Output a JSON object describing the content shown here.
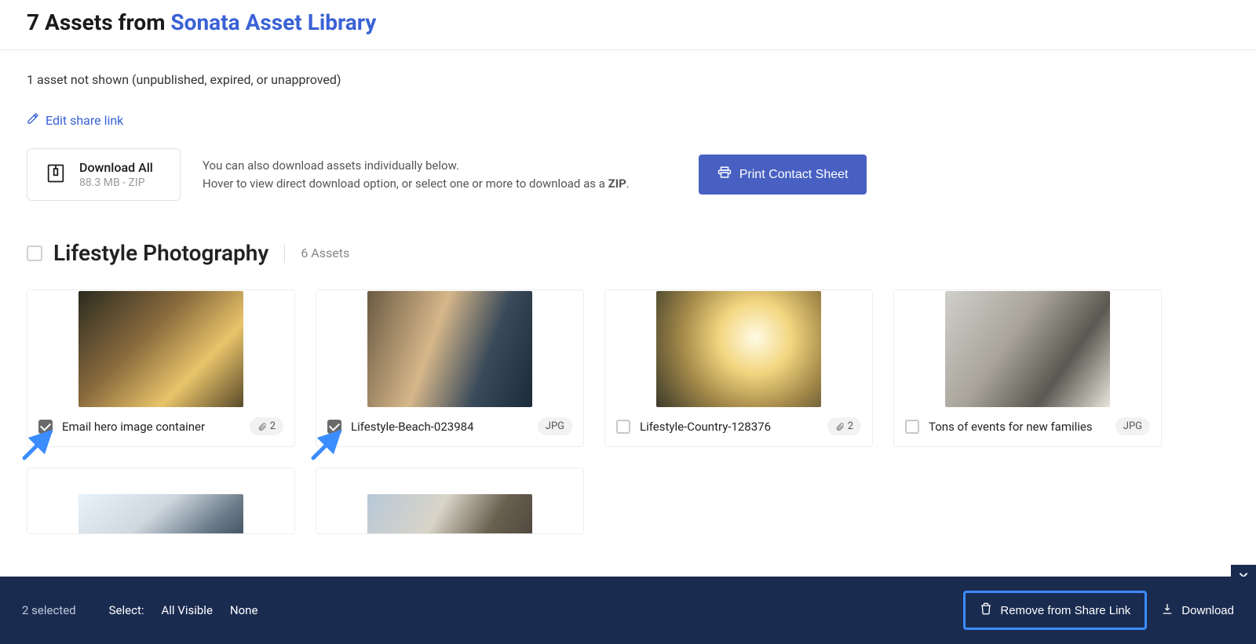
{
  "header": {
    "prefix": "7 Assets from ",
    "link": "Sonata Asset Library"
  },
  "not_shown": "1 asset not shown (unpublished, expired, or unapproved)",
  "edit_link": "Edit share link",
  "download_all": {
    "label": "Download All",
    "sub": "88.3 MB - ZIP"
  },
  "help_line1": "You can also download assets individually below.",
  "help_line2_a": "Hover to view direct download option, or select one or more to download as a ",
  "help_line2_b": "ZIP",
  "help_line2_c": ".",
  "print_btn": "Print Contact Sheet",
  "section": {
    "title": "Lifestyle Photography",
    "count": "6 Assets"
  },
  "assets": [
    {
      "name": "Email hero image container",
      "badge_type": "attach",
      "badge_text": "2",
      "checked": true,
      "img": "img-a"
    },
    {
      "name": "Lifestyle-Beach-023984",
      "badge_type": "text",
      "badge_text": "JPG",
      "checked": true,
      "img": "img-b"
    },
    {
      "name": "Lifestyle-Country-128376",
      "badge_type": "attach",
      "badge_text": "2",
      "checked": false,
      "img": "img-c"
    },
    {
      "name": "Tons of events for new families",
      "badge_type": "text",
      "badge_text": "JPG",
      "checked": false,
      "img": "img-d"
    },
    {
      "name": "",
      "badge_type": "none",
      "badge_text": "",
      "checked": false,
      "img": "img-e"
    },
    {
      "name": "",
      "badge_type": "none",
      "badge_text": "",
      "checked": false,
      "img": "img-f"
    }
  ],
  "footer": {
    "selected": "2 selected",
    "select_label": "Select:",
    "all_visible": "All Visible",
    "none": "None",
    "remove": "Remove from Share Link",
    "download": "Download"
  }
}
